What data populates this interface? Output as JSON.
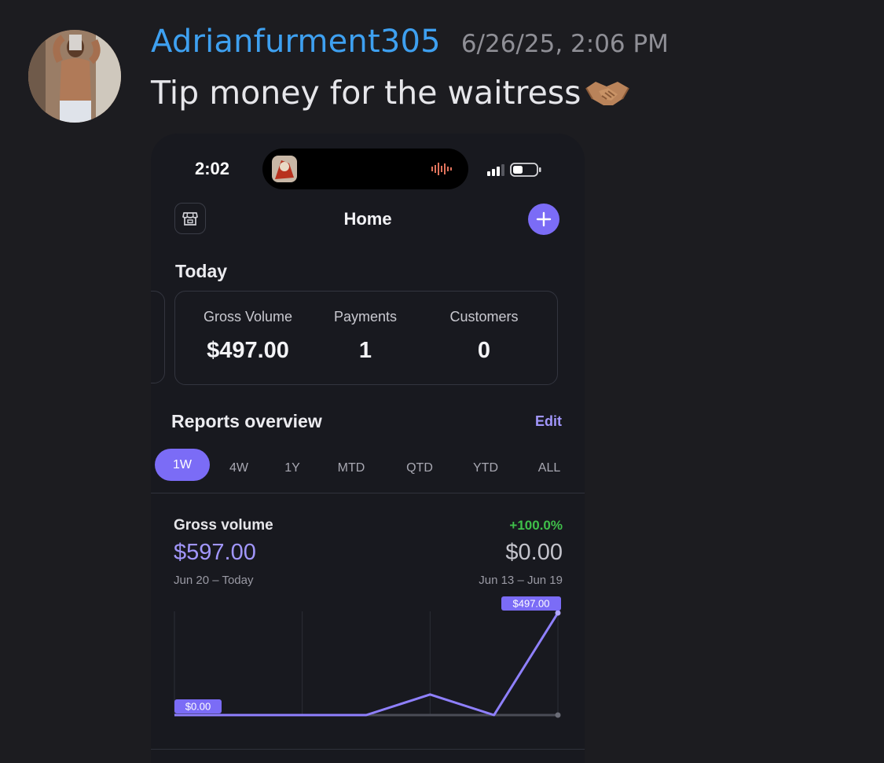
{
  "message": {
    "username": "Adrianfurment305",
    "timestamp": "6/26/25, 2:06 PM",
    "text": "Tip money for the waitress",
    "emoji": "handshake-emoji"
  },
  "phone": {
    "status_time": "2:02",
    "header": {
      "title": "Home",
      "left_icon": "store-icon",
      "right_icon": "plus-icon"
    },
    "today": {
      "label": "Today",
      "stats": [
        {
          "label": "Gross Volume",
          "value": "$497.00"
        },
        {
          "label": "Payments",
          "value": "1"
        },
        {
          "label": "Customers",
          "value": "0"
        }
      ]
    },
    "reports": {
      "title": "Reports overview",
      "edit_label": "Edit",
      "tabs": [
        "1W",
        "4W",
        "1Y",
        "MTD",
        "QTD",
        "YTD",
        "ALL"
      ],
      "active_tab": "1W"
    },
    "gross_volume": {
      "title": "Gross volume",
      "change": "+100.0%",
      "current_value": "$597.00",
      "previous_value": "$0.00",
      "current_range": "Jun 20 – Today",
      "previous_range": "Jun 13 – Jun 19"
    },
    "colors": {
      "accent": "#7b6cf6",
      "positive": "#3fbf4a",
      "background": "#18191f",
      "username": "#3ea0f0"
    }
  },
  "chart_data": {
    "type": "line",
    "series": [
      {
        "values": [
          0,
          0,
          0,
          0,
          100,
          0,
          497
        ]
      },
      {
        "values": [
          0,
          0,
          0,
          0,
          0,
          0,
          0
        ]
      }
    ],
    "ylim": [
      0,
      497
    ],
    "annotations": [
      "$497.00",
      "$0.00"
    ]
  }
}
